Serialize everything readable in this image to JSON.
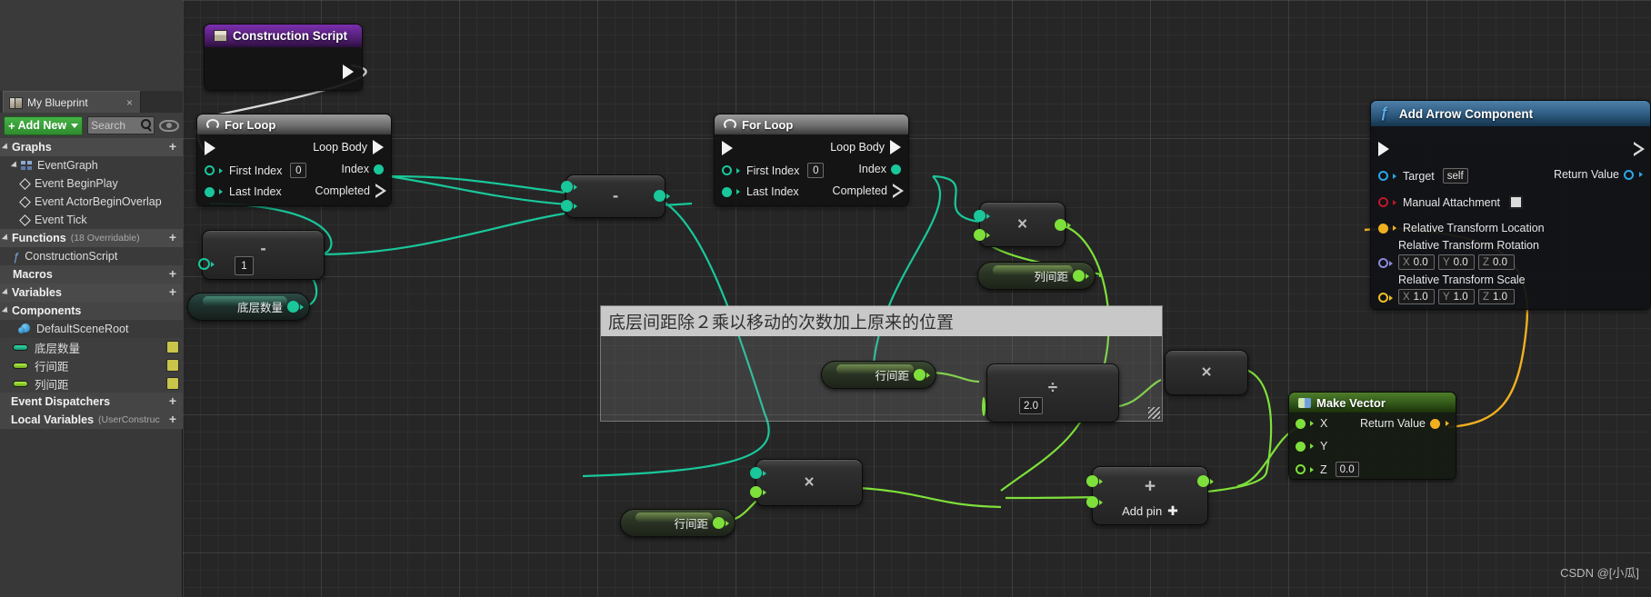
{
  "app": {
    "watermark": "CSDN @[小瓜]"
  },
  "sidebar": {
    "tab": {
      "label": "My Blueprint",
      "icon": "book-icon",
      "close": "×"
    },
    "toolbar": {
      "add_new_label": "Add New",
      "add_new_plus": "+",
      "search_placeholder": "Search",
      "search_value": "",
      "search_icon": "magnifier-icon",
      "eye_icon": "eye-icon"
    },
    "sections": [
      {
        "id": "graphs",
        "label": "Graphs",
        "suffix": "",
        "kind": "section",
        "icon": "triangle-collapse-icon",
        "add": "+"
      },
      {
        "id": "eventgraph",
        "label": "EventGraph",
        "suffix": "",
        "kind": "item",
        "icon": "eventgraph-icon",
        "indent": 1
      },
      {
        "id": "event-beginplay",
        "label": "Event BeginPlay",
        "suffix": "",
        "kind": "item",
        "icon": "diamond-icon",
        "indent": 2
      },
      {
        "id": "event-actorbeginoverlap",
        "label": "Event ActorBeginOverlap",
        "suffix": "",
        "kind": "item",
        "icon": "diamond-icon",
        "indent": 2
      },
      {
        "id": "event-tick",
        "label": "Event Tick",
        "suffix": "",
        "kind": "item",
        "icon": "diamond-icon",
        "indent": 2
      },
      {
        "id": "functions",
        "label": "Functions",
        "suffix": "(18 Overridable)",
        "kind": "section",
        "icon": "triangle-collapse-icon",
        "add": "+"
      },
      {
        "id": "constructionscript",
        "label": "ConstructionScript",
        "suffix": "",
        "kind": "item",
        "icon": "function-icon",
        "indent": 1
      },
      {
        "id": "macros",
        "label": "Macros",
        "suffix": "",
        "kind": "section-plain",
        "icon": "",
        "add": "+"
      },
      {
        "id": "variables",
        "label": "Variables",
        "suffix": "",
        "kind": "section",
        "icon": "triangle-collapse-icon",
        "add": "+"
      },
      {
        "id": "components",
        "label": "Components",
        "suffix": "",
        "kind": "section",
        "icon": "triangle-collapse-icon",
        "add": ""
      },
      {
        "id": "defaultsceneroot",
        "label": "DefaultSceneRoot",
        "suffix": "",
        "kind": "item",
        "icon": "sphere-icon",
        "indent": 2
      },
      {
        "id": "var-dicengshuliang",
        "label": "底层数量",
        "suffix": "",
        "kind": "variable",
        "color": "#19c79a"
      },
      {
        "id": "var-hangjianju",
        "label": "行间距",
        "suffix": "",
        "kind": "variable",
        "color": "#7ee03a"
      },
      {
        "id": "var-liejianju",
        "label": "列间距",
        "suffix": "",
        "kind": "variable",
        "color": "#7ee03a"
      },
      {
        "id": "event-dispatchers",
        "label": "Event Dispatchers",
        "suffix": "",
        "kind": "section-plain",
        "icon": "",
        "add": "+"
      },
      {
        "id": "local-variables",
        "label": "Local Variables",
        "suffix": "(UserConstruc",
        "kind": "section-plain",
        "icon": "",
        "add": "+"
      }
    ]
  },
  "graph": {
    "nodes": {
      "construction_script": {
        "title": "Construction Script",
        "icon": "construction-script-icon",
        "out_exec": "exec-out-pin"
      },
      "for_loop_1": {
        "title": "For Loop",
        "icon": "loop-icon",
        "inputs": [
          {
            "name": "exec-in",
            "label": ""
          },
          {
            "name": "first-index",
            "label": "First Index",
            "value": "0"
          },
          {
            "name": "last-index",
            "label": "Last Index",
            "value": ""
          }
        ],
        "outputs": [
          {
            "name": "loop-body",
            "label": "Loop Body"
          },
          {
            "name": "index",
            "label": "Index"
          },
          {
            "name": "completed",
            "label": "Completed"
          }
        ]
      },
      "for_loop_2": {
        "title": "For Loop",
        "icon": "loop-icon",
        "inputs": [
          {
            "name": "exec-in",
            "label": ""
          },
          {
            "name": "first-index",
            "label": "First Index",
            "value": "0"
          },
          {
            "name": "last-index",
            "label": "Last Index",
            "value": ""
          }
        ],
        "outputs": [
          {
            "name": "loop-body",
            "label": "Loop Body"
          },
          {
            "name": "index",
            "label": "Index"
          },
          {
            "name": "completed",
            "label": "Completed"
          }
        ]
      },
      "add_arrow_component": {
        "title": "Add Arrow Component",
        "icon": "function-f-icon",
        "target_label": "Target",
        "target_value": "self",
        "manual_attachment_label": "Manual Attachment",
        "manual_attachment_checked": false,
        "relative_transform_location_label": "Relative Transform Location",
        "relative_transform_rotation_label": "Relative Transform Rotation",
        "rotation": {
          "x_label": "X",
          "x": "0.0",
          "y_label": "Y",
          "y": "0.0",
          "z_label": "Z",
          "z": "0.0"
        },
        "relative_transform_scale_label": "Relative Transform Scale",
        "scale": {
          "x_label": "X",
          "x": "1.0",
          "y_label": "Y",
          "y": "1.0",
          "z_label": "Z",
          "z": "1.0"
        },
        "return_value_label": "Return Value"
      },
      "make_vector": {
        "title": "Make Vector",
        "icon": "make-vector-icon",
        "inputs": [
          {
            "name": "x",
            "label": "X"
          },
          {
            "name": "y",
            "label": "Y"
          },
          {
            "name": "z",
            "label": "Z",
            "value": "0.0"
          }
        ],
        "return_value_label": "Return Value"
      },
      "subtract_1": {
        "glyph": "-",
        "value": "1",
        "op": "subtract"
      },
      "subtract_2": {
        "glyph": "-",
        "op": "subtract"
      },
      "multiply_top": {
        "glyph": "×",
        "op": "multiply"
      },
      "multiply_mid": {
        "glyph": "×",
        "op": "multiply"
      },
      "multiply_bottom": {
        "glyph": "×",
        "op": "multiply"
      },
      "divide": {
        "glyph": "÷",
        "value": "2.0",
        "op": "divide"
      },
      "add_node": {
        "glyph": "+",
        "add_pin_label": "Add pin",
        "add_pin_glyph": "✚",
        "op": "add"
      }
    },
    "getters": {
      "dicengshuliang": "底层数量",
      "liejianju": "列间距",
      "hangjianju_comment": "行间距",
      "hangjianju_bottom": "行间距"
    },
    "comment": {
      "title": "底层间距除２乘以移动的次数加上原来的位置"
    }
  },
  "colors": {
    "exec_white": "#f2f2f2",
    "int_teal": "#19c79a",
    "float_green": "#7ee03a",
    "object_blue": "#2aa7e8",
    "bool_red": "#c0172a",
    "vector_yellow": "#f0b020",
    "rotator_purple": "#8a8ad8",
    "canvas_bg": "#262626"
  }
}
